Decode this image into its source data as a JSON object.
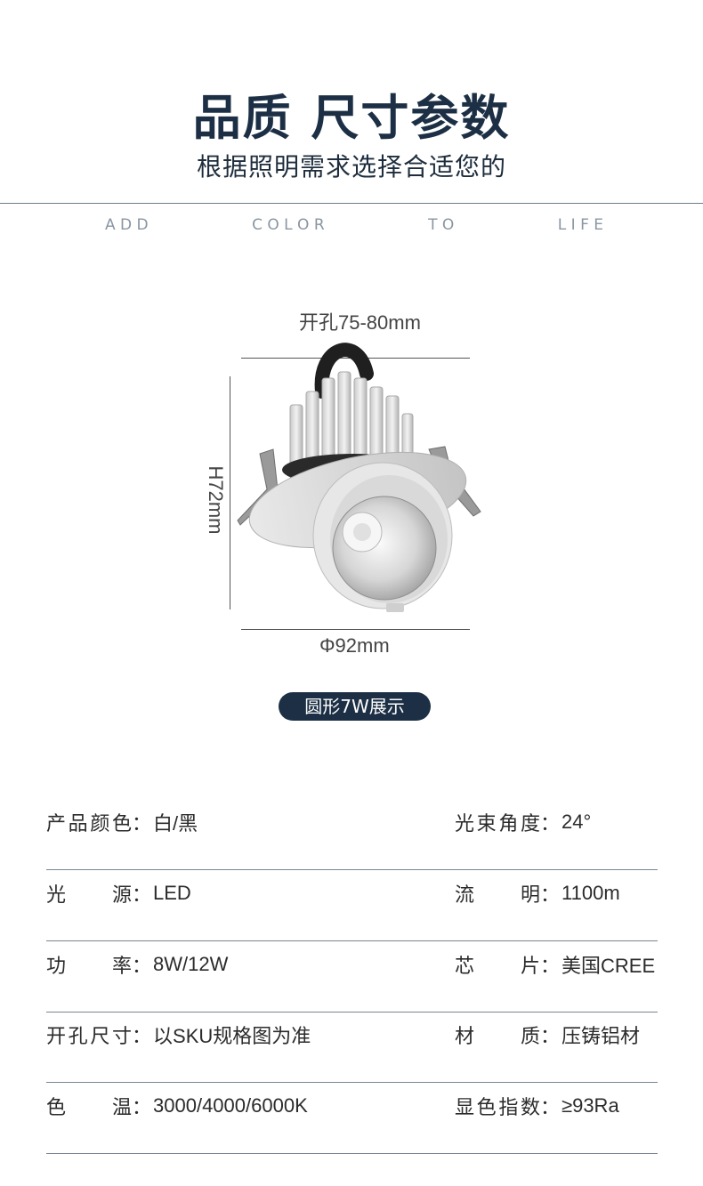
{
  "header": {
    "title": "品质 尺寸参数",
    "subtitle": "根据照明需求选择合适您的",
    "slogan": [
      "A D D",
      "C O L O R",
      "T O",
      "L I F E"
    ]
  },
  "product_figure": {
    "opening_label": "开孔75-80mm",
    "height_label": "H72mm",
    "diameter_label": "Φ92mm"
  },
  "badge": {
    "label": "圆形7W展示"
  },
  "specs": [
    {
      "left": {
        "k": [
          "产",
          "品",
          "颜",
          "色"
        ],
        "v": "白/黑"
      },
      "right": {
        "k": [
          "光",
          "束",
          "角",
          "度"
        ],
        "v": "24°"
      }
    },
    {
      "left": {
        "k": [
          "光",
          "源"
        ],
        "v": "LED"
      },
      "right": {
        "k": [
          "流",
          "明"
        ],
        "v": "1100m"
      }
    },
    {
      "left": {
        "k": [
          "功",
          "率"
        ],
        "v": "8W/12W"
      },
      "right": {
        "k": [
          "芯",
          "片"
        ],
        "v": "美国CREE"
      }
    },
    {
      "left": {
        "k": [
          "开",
          "孔",
          "尺",
          "寸"
        ],
        "v": "以SKU规格图为准"
      },
      "right": {
        "k": [
          "材",
          "质"
        ],
        "v": "压铸铝材"
      }
    },
    {
      "left": {
        "k": [
          "色",
          "温"
        ],
        "v": "3000/4000/6000K"
      },
      "right": {
        "k": [
          "显",
          "色",
          "指",
          "数"
        ],
        "v": "≥93Ra"
      }
    }
  ],
  "colors": {
    "dark_navy": "#1c2f45",
    "rule": "#7a8591"
  }
}
